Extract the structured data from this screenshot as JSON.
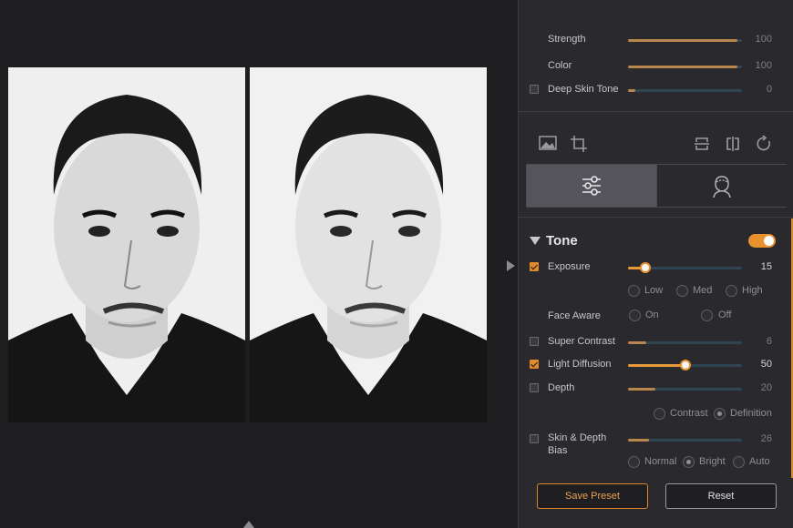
{
  "sliders_top": [
    {
      "label": "Strength",
      "value": "100",
      "fraction": 0.96
    },
    {
      "label": "Color",
      "value": "100",
      "fraction": 0.96
    },
    {
      "label": "Deep Skin Tone",
      "value": "0",
      "fraction": 0.06
    }
  ],
  "tools": {
    "left": [
      "image-icon",
      "crop-icon"
    ],
    "right": [
      "flip-vertical-icon",
      "flip-horizontal-icon",
      "rotate-icon"
    ]
  },
  "tabs": [
    "sliders-icon",
    "face-portrait-icon"
  ],
  "tone": {
    "title": "Tone",
    "toggle_on": true,
    "exposure": {
      "label": "Exposure",
      "value": "15",
      "fraction": 0.15,
      "checked": true
    },
    "exposure_levels": [
      "Low",
      "Med",
      "High"
    ],
    "face_aware": {
      "label": "Face Aware",
      "options": [
        "On",
        "Off"
      ]
    },
    "super_contrast": {
      "label": "Super Contrast",
      "value": "6",
      "fraction": 0.16,
      "checked": false
    },
    "light_diffusion": {
      "label": "Light Diffusion",
      "value": "50",
      "fraction": 0.5,
      "checked": true
    },
    "depth": {
      "label": "Depth",
      "value": "20",
      "fraction": 0.24,
      "checked": false
    },
    "depth_modes": [
      {
        "label": "Contrast",
        "selected": false
      },
      {
        "label": "Definition",
        "selected": true
      }
    ],
    "skin_depth_bias": {
      "label_line1": "Skin & Depth",
      "label_line2": "Bias",
      "value": "26",
      "fraction": 0.18,
      "checked": false
    },
    "bias_modes": [
      {
        "label": "Normal",
        "selected": false
      },
      {
        "label": "Bright",
        "selected": true
      },
      {
        "label": "Auto",
        "selected": false
      }
    ]
  },
  "buttons": {
    "save": "Save Preset",
    "reset": "Reset"
  },
  "colors": {
    "accent": "#e8922e",
    "panel": "#2a2a2e",
    "canvas": "#1e1e21",
    "track": "#2f4552"
  }
}
